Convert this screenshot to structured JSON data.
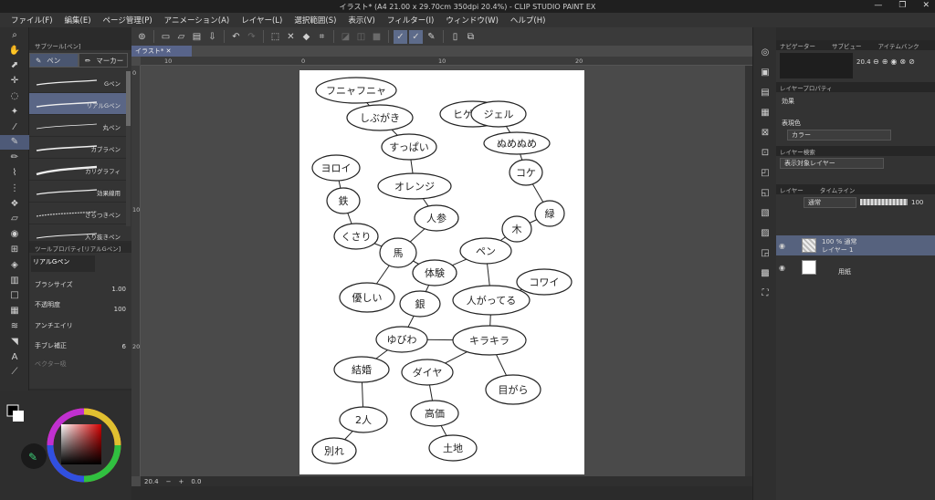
{
  "window": {
    "title": "イラスト* (A4 21.00 x 29.70cm 350dpi 20.4%) - CLIP STUDIO PAINT EX",
    "controls": [
      "—",
      "❐",
      "✕"
    ]
  },
  "menu": [
    "ファイル(F)",
    "編集(E)",
    "ページ管理(P)",
    "アニメーション(A)",
    "レイヤー(L)",
    "選択範囲(S)",
    "表示(V)",
    "フィルター(I)",
    "ウィンドウ(W)",
    "ヘルプ(H)"
  ],
  "document_tab": "イラスト*",
  "ruler": {
    "top": [
      "10",
      "0",
      "10",
      "20"
    ],
    "left": [
      "0",
      "10",
      "20"
    ]
  },
  "subtool": {
    "header": "サブツール[ペン]",
    "tabs": [
      "ペン",
      "マーカー"
    ],
    "brushes": [
      "Gペン",
      "リアルGペン",
      "丸ペン",
      "カブラペン",
      "カリグラフィ",
      "効果線用",
      "ざらつきペン",
      "入り抜きペン"
    ],
    "selected_index": 1
  },
  "tool_property": {
    "header": "ツールプロパティ[リアルGペン]",
    "preset": "リアルGペン",
    "brush_size_label": "ブラシサイズ",
    "brush_size_value": "1.00",
    "opacity_label": "不透明度",
    "opacity_value": "100",
    "anti_alias_label": "アンチエイリ",
    "stabilization_label": "手ブレ補正",
    "stabilization_value": "6",
    "vector_label": "ベクター吸"
  },
  "statusbar": {
    "zoom": "20.4",
    "angle": "0.0"
  },
  "right_panel": {
    "navigator_tabs": [
      "ナビゲーター",
      "サブビュー",
      "アイテムバンク"
    ],
    "navigator_zoom": "20.4",
    "layer_property_header": "レイヤープロパティ",
    "effect_label": "効果",
    "expression_color_label": "表現色",
    "expression_color_value": "カラー",
    "layer_search_header": "レイヤー検索",
    "layer_search_value": "表示対象レイヤー",
    "layer_tabs": [
      "レイヤー",
      "タイムライン"
    ],
    "blend_mode": "通常",
    "layer_opacity": "100",
    "layers": [
      {
        "line1": "100 % 通常",
        "line2": "レイヤー 1",
        "selected": true
      },
      {
        "line1": "",
        "line2": "用紙",
        "selected": false
      }
    ]
  },
  "drawing": {
    "words": [
      "フニャフニャ",
      "しぶがき",
      "すっぱい",
      "ヒゲソリ",
      "ジェル",
      "ぬめぬめ",
      "コケ",
      "緑",
      "木",
      "ヨロイ",
      "鉄",
      "くさり",
      "オレンジ",
      "人参",
      "馬",
      "体験",
      "ペン",
      "コワイ",
      "優しい",
      "銀",
      "人がってる",
      "ゆびわ",
      "キラキラ",
      "結婚",
      "ダイヤ",
      "目がら",
      "2人",
      "高価",
      "別れ",
      "土地"
    ]
  },
  "colors": {
    "accent": "#58648a",
    "selected": "#5a6686"
  }
}
